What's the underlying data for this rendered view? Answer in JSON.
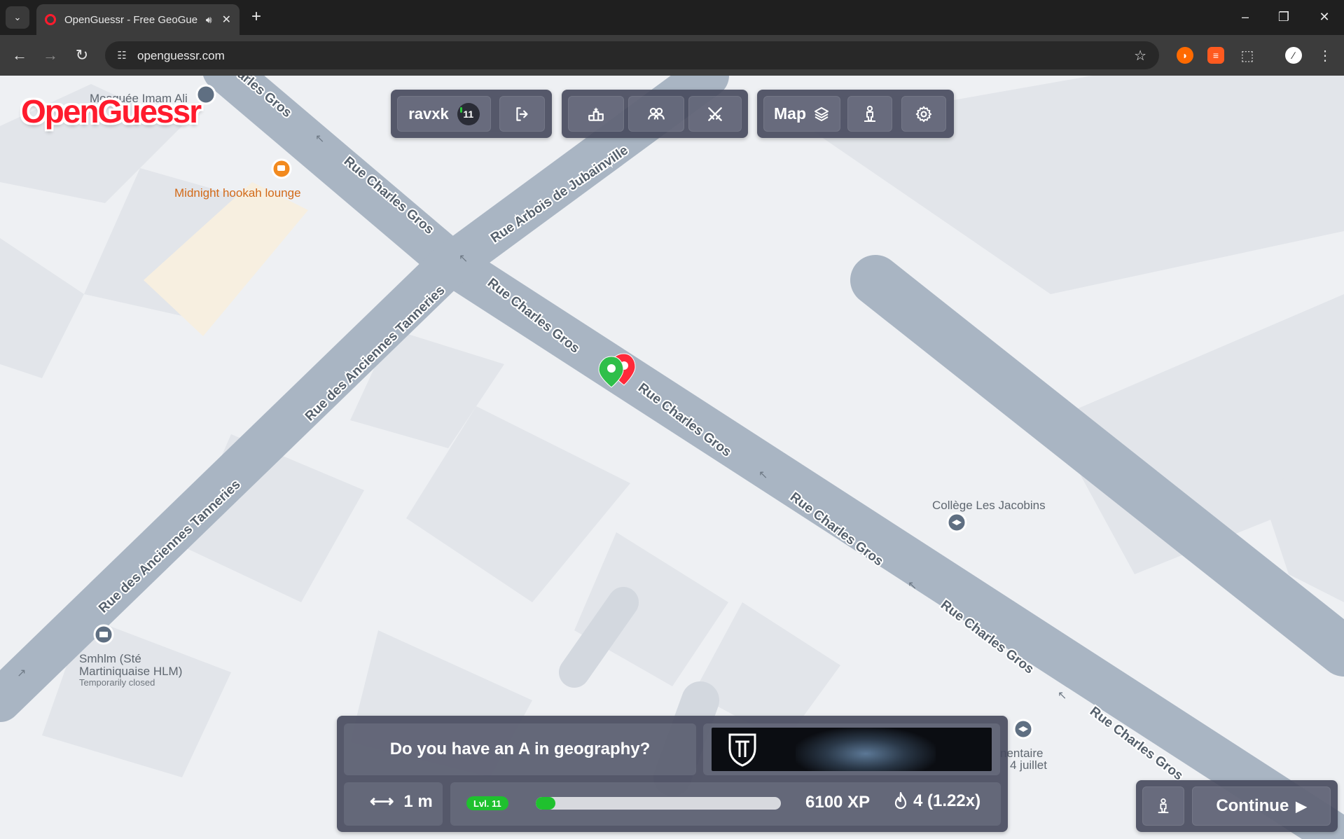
{
  "browser": {
    "tab_title": "OpenGuessr - Free GeoGue",
    "url": "openguessr.com",
    "tab_search_icon": "chevron-down-icon",
    "audio_icon": "speaker-icon"
  },
  "logo": {
    "text": "OpenGuessr"
  },
  "topbar": {
    "username": "ravxk",
    "level_badge": "11",
    "logout_icon": "logout-icon",
    "leaderboard_icon": "podium-icon",
    "friends_icon": "friends-icon",
    "battle_icon": "crossed-swords-icon",
    "map_label": "Map",
    "map_layers_icon": "layers-icon",
    "streetview_icon": "pegman-icon",
    "settings_icon": "gear-icon"
  },
  "map": {
    "streets": {
      "charles_gros": "Rue Charles Gros",
      "charles_gros_partial": "arles Gros",
      "arbois": "Rue Arbois de Jubainville",
      "tanneries": "Rue des Anciennes Tanneries"
    },
    "pois": {
      "mosque": "Mosquée Imam Ali",
      "hookah": "Midnight hookah lounge",
      "college": "Collège Les Jacobins",
      "smhlm_line1": "Smhlm (Sté",
      "smhlm_line2": "Martiniquaise HLM)",
      "smhlm_status": "Temporarily closed",
      "school_line1": "nentaire",
      "school_line2": "4 juillet"
    },
    "colors": {
      "road": "#a9b5c3",
      "ground": "#eef0f3",
      "guess_marker": "#2fbf4a",
      "answer_marker": "#ff2a3a"
    }
  },
  "result": {
    "question": "Do you have an A in geography?",
    "distance": "1 m",
    "level_pill": "Lvl. 11",
    "xp_progress": 0.08,
    "xp": "6100 XP",
    "streak": "4 (1.22x)",
    "continue_label": "Continue"
  }
}
